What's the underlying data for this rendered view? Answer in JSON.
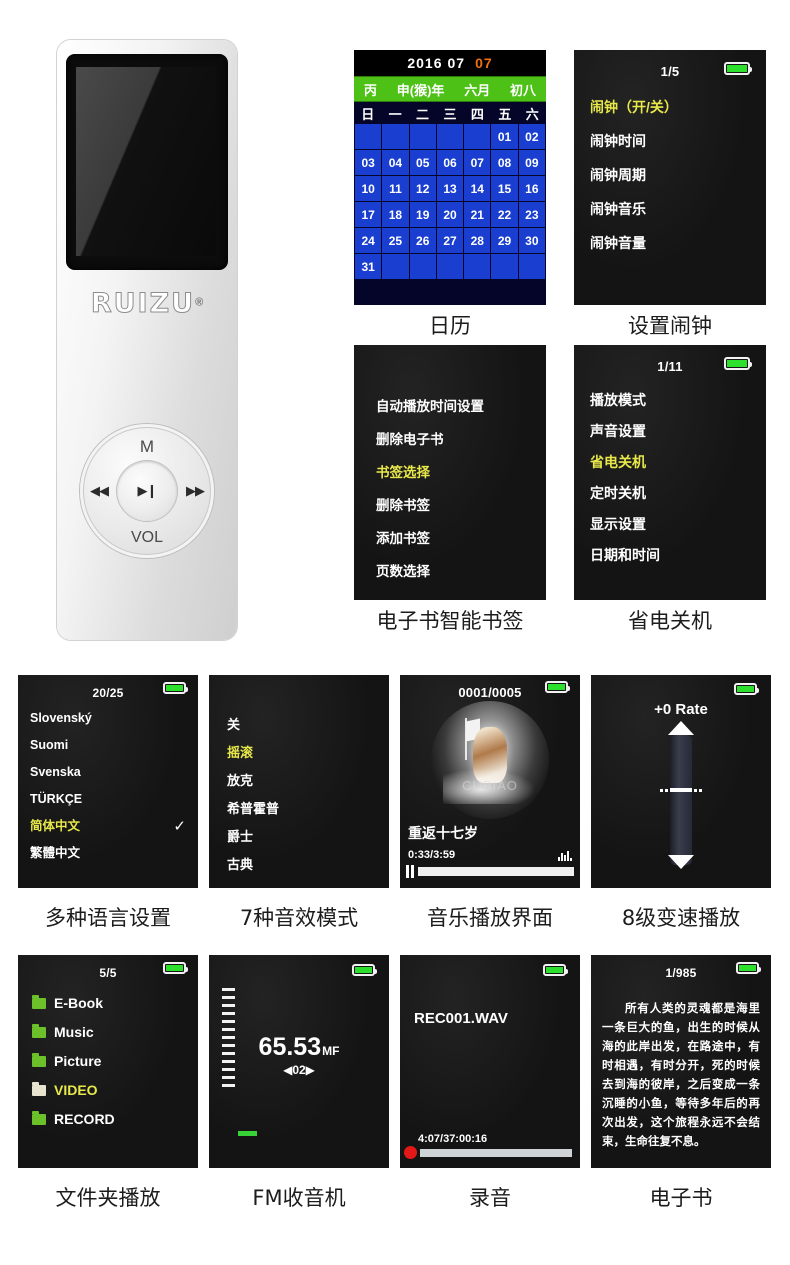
{
  "device": {
    "brand": "RUIZU",
    "registered_mark": "®",
    "wheel": {
      "top_label": "M",
      "bottom_label": "VOL",
      "prev_icon": "previous-track-icon",
      "next_icon": "next-track-icon",
      "play_pause_icon": "play-pause-icon"
    }
  },
  "calendar": {
    "caption": "日历",
    "year": "2016",
    "month": "07",
    "day": "07",
    "lunar": [
      "丙",
      "申(猴)年",
      "六月",
      "初八"
    ],
    "weekdays": [
      "日",
      "一",
      "二",
      "三",
      "四",
      "五",
      "六"
    ],
    "leading_blanks": 5,
    "days": [
      "01",
      "02",
      "03",
      "04",
      "05",
      "06",
      "07",
      "08",
      "09",
      "10",
      "11",
      "12",
      "13",
      "14",
      "15",
      "16",
      "17",
      "18",
      "19",
      "20",
      "21",
      "22",
      "23",
      "24",
      "25",
      "26",
      "27",
      "28",
      "29",
      "30",
      "31"
    ],
    "trailing_blanks": 6,
    "colors": {
      "lunar_bar": "#4ec117",
      "cell": "#1a3fd0",
      "highlight_day": "#f07010"
    }
  },
  "alarm": {
    "caption": "设置闹钟",
    "count": "1/5",
    "items": [
      {
        "label": "闹钟（开/关）",
        "selected": true
      },
      {
        "label": "闹钟时间",
        "selected": false
      },
      {
        "label": "闹钟周期",
        "selected": false
      },
      {
        "label": "闹钟音乐",
        "selected": false
      },
      {
        "label": "闹钟音量",
        "selected": false
      }
    ]
  },
  "ebook_bookmark": {
    "caption": "电子书智能书签",
    "count": "",
    "items": [
      {
        "label": "自动播放时间设置",
        "selected": false
      },
      {
        "label": "删除电子书",
        "selected": false
      },
      {
        "label": "书签选择",
        "selected": true
      },
      {
        "label": "删除书签",
        "selected": false
      },
      {
        "label": "添加书签",
        "selected": false
      },
      {
        "label": "页数选择",
        "selected": false
      }
    ]
  },
  "power_settings": {
    "caption": "省电关机",
    "count": "1/11",
    "items": [
      {
        "label": "播放模式",
        "selected": false
      },
      {
        "label": "声音设置",
        "selected": false
      },
      {
        "label": "省电关机",
        "selected": true
      },
      {
        "label": "定时关机",
        "selected": false
      },
      {
        "label": "显示设置",
        "selected": false
      },
      {
        "label": "日期和时间",
        "selected": false
      }
    ]
  },
  "language": {
    "caption": "多种语言设置",
    "count": "20/25",
    "check_mark": "✓",
    "items": [
      {
        "label": "Slovenský",
        "selected": false,
        "checked": false
      },
      {
        "label": "Suomi",
        "selected": false,
        "checked": false
      },
      {
        "label": "Svenska",
        "selected": false,
        "checked": false
      },
      {
        "label": "TÜRKÇE",
        "selected": false,
        "checked": false
      },
      {
        "label": "简体中文",
        "selected": true,
        "checked": true
      },
      {
        "label": "繁體中文",
        "selected": false,
        "checked": false
      }
    ]
  },
  "equalizer": {
    "caption": "7种音效模式",
    "items": [
      {
        "label": "关",
        "selected": false
      },
      {
        "label": "摇滚",
        "selected": true
      },
      {
        "label": "放克",
        "selected": false
      },
      {
        "label": "希普霍普",
        "selected": false
      },
      {
        "label": "爵士",
        "selected": false
      },
      {
        "label": "古典",
        "selected": false
      }
    ]
  },
  "player": {
    "caption": "音乐播放界面",
    "count": "0001/0005",
    "track_title": "重返十七岁",
    "time": "0:33/3:59",
    "progress_percent": 38,
    "album_watermark": "CUBIAO",
    "pause_icon": "pause-icon",
    "eq_icon": "equalizer-bars-icon"
  },
  "rate": {
    "caption": "8级变速播放",
    "label": "+0 Rate",
    "up_icon": "triangle-up-icon",
    "down_icon": "triangle-down-icon"
  },
  "folder": {
    "caption": "文件夹播放",
    "count": "5/5",
    "items": [
      {
        "label": "E-Book",
        "selected": false
      },
      {
        "label": "Music",
        "selected": false
      },
      {
        "label": "Picture",
        "selected": false
      },
      {
        "label": "VIDEO",
        "selected": true
      },
      {
        "label": "RECORD",
        "selected": false
      }
    ]
  },
  "fm": {
    "caption": "FM收音机",
    "frequency": "65.53",
    "unit": "MF",
    "preset": "02",
    "left_arrow": "◀",
    "right_arrow": "▶",
    "scale_ticks": 13
  },
  "record": {
    "caption": "录音",
    "filename": "REC001.WAV",
    "time": "4:07/37:00:16",
    "progress_percent": 11,
    "rec_icon": "record-dot-icon"
  },
  "ebook": {
    "caption": "电子书",
    "count": "1/985",
    "text": "所有人类的灵魂都是海里一条巨大的鱼，出生的时候从海的此岸出发，在路途中，有时相遇，有时分开，死的时候去到海的彼岸，之后变成一条沉睡的小鱼，等待多年后的再次出发，这个旅程永远不会结束，生命往复不息。"
  }
}
